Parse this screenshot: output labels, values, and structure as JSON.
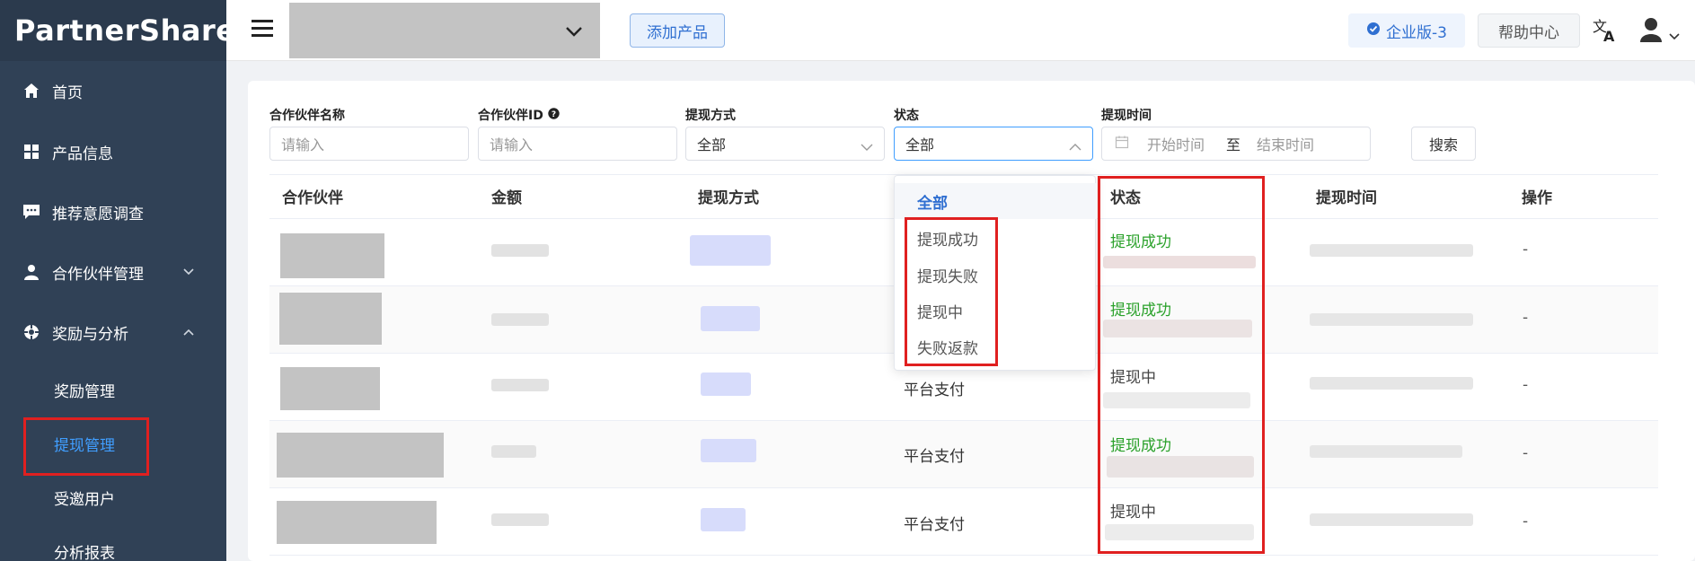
{
  "app": {
    "logo": "PartnerShare"
  },
  "sidebar": {
    "items": [
      {
        "label": "首页",
        "icon": "home-icon"
      },
      {
        "label": "产品信息",
        "icon": "grid-icon"
      },
      {
        "label": "推荐意愿调查",
        "icon": "chat-icon"
      },
      {
        "label": "合作伙伴管理",
        "icon": "user-icon",
        "chevron": "down"
      },
      {
        "label": "奖励与分析",
        "icon": "gear-icon",
        "chevron": "up"
      }
    ],
    "sub_items": [
      {
        "label": "奖励管理"
      },
      {
        "label": "提现管理",
        "active": true
      },
      {
        "label": "受邀用户"
      },
      {
        "label": "分析报表"
      }
    ]
  },
  "header": {
    "add_product": "添加产品",
    "edition": "企业版-3",
    "help": "帮助中心"
  },
  "filters": {
    "partner_name": {
      "label": "合作伙伴名称",
      "placeholder": "请输入"
    },
    "partner_id": {
      "label": "合作伙伴ID",
      "placeholder": "请输入"
    },
    "method": {
      "label": "提现方式",
      "value": "全部"
    },
    "status": {
      "label": "状态",
      "value": "全部"
    },
    "time": {
      "label": "提现时间",
      "start": "开始时间",
      "sep": "至",
      "end": "结束时间"
    },
    "search": "搜索"
  },
  "table": {
    "headers": [
      "合作伙伴",
      "金额",
      "提现方式",
      "状态",
      "提现时间",
      "操作"
    ],
    "rows": [
      {
        "method": "",
        "status": "提现成功",
        "status_type": "ok",
        "action": "-"
      },
      {
        "method": "",
        "status": "提现成功",
        "status_type": "ok",
        "action": "-"
      },
      {
        "method": "平台支付",
        "status": "提现中",
        "status_type": "mid",
        "action": "-"
      },
      {
        "method": "平台支付",
        "status": "提现成功",
        "status_type": "ok",
        "action": "-"
      },
      {
        "method": "平台支付",
        "status": "提现中",
        "status_type": "mid",
        "action": "-"
      }
    ]
  },
  "status_dropdown": {
    "options": [
      "全部",
      "提现成功",
      "提现失败",
      "提现中",
      "失败返款"
    ],
    "selected": "全部"
  },
  "colors": {
    "sidebar": "#304156",
    "accent": "#409eff",
    "success": "#2aa12a",
    "highlight": "#e02020"
  }
}
